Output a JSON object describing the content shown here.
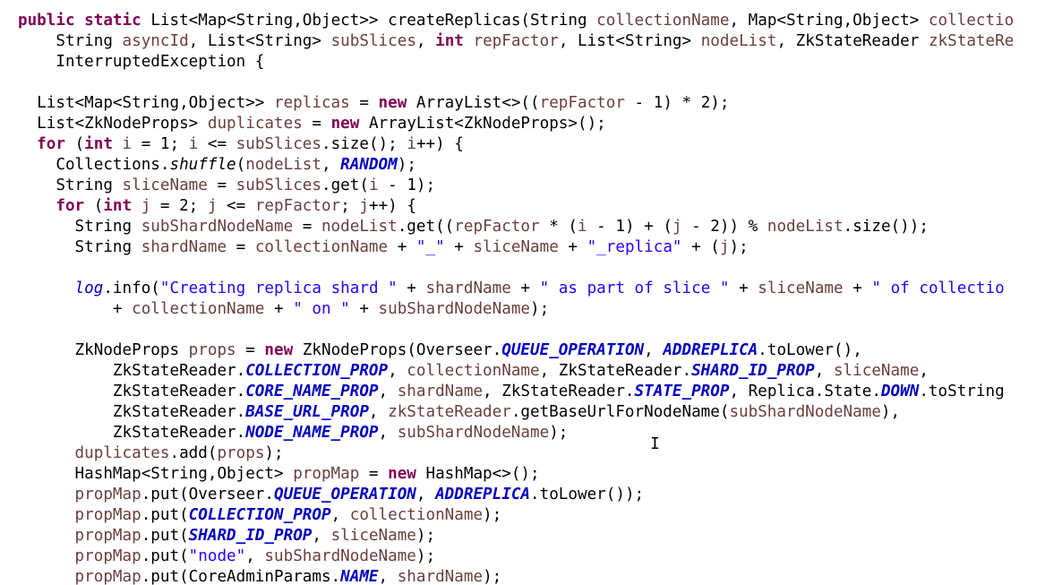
{
  "editor": {
    "cursor_glyph": "I",
    "lines": [
      [
        [
          "kw",
          "public "
        ],
        [
          "kw",
          "static "
        ],
        [
          "pl",
          "List<Map<String,Object>> createReplicas(String "
        ],
        [
          "var",
          "collectionName"
        ],
        [
          "pl",
          ", Map<String,Object> "
        ],
        [
          "var",
          "collectio"
        ]
      ],
      [
        [
          "pl",
          "    String "
        ],
        [
          "var",
          "asyncId"
        ],
        [
          "pl",
          ", List<String> "
        ],
        [
          "var",
          "subSlices"
        ],
        [
          "pl",
          ", "
        ],
        [
          "kw",
          "int "
        ],
        [
          "var",
          "repFactor"
        ],
        [
          "pl",
          ", List<String> "
        ],
        [
          "var",
          "nodeList"
        ],
        [
          "pl",
          ", ZkStateReader "
        ],
        [
          "var",
          "zkStateRe"
        ]
      ],
      [
        [
          "pl",
          "    InterruptedException {"
        ]
      ],
      [
        [
          "pl",
          ""
        ]
      ],
      [
        [
          "pl",
          "  List<Map<String,Object>> "
        ],
        [
          "var",
          "replicas"
        ],
        [
          "pl",
          " = "
        ],
        [
          "kw",
          "new "
        ],
        [
          "pl",
          "ArrayList<>(("
        ],
        [
          "var",
          "repFactor"
        ],
        [
          "pl",
          " - 1) * 2);"
        ]
      ],
      [
        [
          "pl",
          "  List<ZkNodeProps> "
        ],
        [
          "var",
          "duplicates"
        ],
        [
          "pl",
          " = "
        ],
        [
          "kw",
          "new "
        ],
        [
          "pl",
          "ArrayList<ZkNodeProps>();"
        ]
      ],
      [
        [
          "kw",
          "  for "
        ],
        [
          "pl",
          "("
        ],
        [
          "kw",
          "int "
        ],
        [
          "var",
          "i"
        ],
        [
          "pl",
          " = 1; "
        ],
        [
          "var",
          "i"
        ],
        [
          "pl",
          " <= "
        ],
        [
          "var",
          "subSlices"
        ],
        [
          "pl",
          ".size(); "
        ],
        [
          "var",
          "i"
        ],
        [
          "pl",
          "++) {"
        ]
      ],
      [
        [
          "pl",
          "    Collections."
        ],
        [
          "it",
          "shuffle"
        ],
        [
          "pl",
          "("
        ],
        [
          "var",
          "nodeList"
        ],
        [
          "pl",
          ", "
        ],
        [
          "sfld",
          "RANDOM"
        ],
        [
          "pl",
          ");"
        ]
      ],
      [
        [
          "pl",
          "    String "
        ],
        [
          "var",
          "sliceName"
        ],
        [
          "pl",
          " = "
        ],
        [
          "var",
          "subSlices"
        ],
        [
          "pl",
          ".get("
        ],
        [
          "var",
          "i"
        ],
        [
          "pl",
          " - 1);"
        ]
      ],
      [
        [
          "kw",
          "    for "
        ],
        [
          "pl",
          "("
        ],
        [
          "kw",
          "int "
        ],
        [
          "var",
          "j"
        ],
        [
          "pl",
          " = 2; "
        ],
        [
          "var",
          "j"
        ],
        [
          "pl",
          " <= "
        ],
        [
          "var",
          "repFactor"
        ],
        [
          "pl",
          "; "
        ],
        [
          "var",
          "j"
        ],
        [
          "pl",
          "++) {"
        ]
      ],
      [
        [
          "pl",
          "      String "
        ],
        [
          "var",
          "subShardNodeName"
        ],
        [
          "pl",
          " = "
        ],
        [
          "var",
          "nodeList"
        ],
        [
          "pl",
          ".get(("
        ],
        [
          "var",
          "repFactor"
        ],
        [
          "pl",
          " * ("
        ],
        [
          "var",
          "i"
        ],
        [
          "pl",
          " - 1) + ("
        ],
        [
          "var",
          "j"
        ],
        [
          "pl",
          " - 2)) % "
        ],
        [
          "var",
          "nodeList"
        ],
        [
          "pl",
          ".size());"
        ]
      ],
      [
        [
          "pl",
          "      String "
        ],
        [
          "var",
          "shardName"
        ],
        [
          "pl",
          " = "
        ],
        [
          "var",
          "collectionName"
        ],
        [
          "pl",
          " + "
        ],
        [
          "str",
          "\"_\""
        ],
        [
          "pl",
          " + "
        ],
        [
          "var",
          "sliceName"
        ],
        [
          "pl",
          " + "
        ],
        [
          "str",
          "\"_replica\""
        ],
        [
          "pl",
          " + ("
        ],
        [
          "var",
          "j"
        ],
        [
          "pl",
          ");"
        ]
      ],
      [
        [
          "pl",
          ""
        ]
      ],
      [
        [
          "sfld-plain",
          "      log"
        ],
        [
          "pl",
          ".info("
        ],
        [
          "str",
          "\"Creating replica shard \""
        ],
        [
          "pl",
          " + "
        ],
        [
          "var",
          "shardName"
        ],
        [
          "pl",
          " + "
        ],
        [
          "str",
          "\" as part of slice \""
        ],
        [
          "pl",
          " + "
        ],
        [
          "var",
          "sliceName"
        ],
        [
          "pl",
          " + "
        ],
        [
          "str",
          "\" of collectio"
        ]
      ],
      [
        [
          "pl",
          "          + "
        ],
        [
          "var",
          "collectionName"
        ],
        [
          "pl",
          " + "
        ],
        [
          "str",
          "\" on \""
        ],
        [
          "pl",
          " + "
        ],
        [
          "var",
          "subShardNodeName"
        ],
        [
          "pl",
          ");"
        ]
      ],
      [
        [
          "pl",
          ""
        ]
      ],
      [
        [
          "pl",
          "      ZkNodeProps "
        ],
        [
          "var",
          "props"
        ],
        [
          "pl",
          " = "
        ],
        [
          "kw",
          "new "
        ],
        [
          "pl",
          "ZkNodeProps(Overseer."
        ],
        [
          "sfld",
          "QUEUE_OPERATION"
        ],
        [
          "pl",
          ", "
        ],
        [
          "sfld",
          "ADDREPLICA"
        ],
        [
          "pl",
          ".toLower(),"
        ]
      ],
      [
        [
          "pl",
          "          ZkStateReader."
        ],
        [
          "sfld",
          "COLLECTION_PROP"
        ],
        [
          "pl",
          ", "
        ],
        [
          "var",
          "collectionName"
        ],
        [
          "pl",
          ", ZkStateReader."
        ],
        [
          "sfld",
          "SHARD_ID_PROP"
        ],
        [
          "pl",
          ", "
        ],
        [
          "var",
          "sliceName"
        ],
        [
          "pl",
          ","
        ]
      ],
      [
        [
          "pl",
          "          ZkStateReader."
        ],
        [
          "sfld",
          "CORE_NAME_PROP"
        ],
        [
          "pl",
          ", "
        ],
        [
          "var",
          "shardName"
        ],
        [
          "pl",
          ", ZkStateReader."
        ],
        [
          "sfld",
          "STATE_PROP"
        ],
        [
          "pl",
          ", Replica.State."
        ],
        [
          "sfld",
          "DOWN"
        ],
        [
          "pl",
          ".toString"
        ]
      ],
      [
        [
          "pl",
          "          ZkStateReader."
        ],
        [
          "sfld",
          "BASE_URL_PROP"
        ],
        [
          "pl",
          ", "
        ],
        [
          "var",
          "zkStateReader"
        ],
        [
          "pl",
          ".getBaseUrlForNodeName("
        ],
        [
          "var",
          "subShardNodeName"
        ],
        [
          "pl",
          "),"
        ]
      ],
      [
        [
          "pl",
          "          ZkStateReader."
        ],
        [
          "sfld",
          "NODE_NAME_PROP"
        ],
        [
          "pl",
          ", "
        ],
        [
          "var",
          "subShardNodeName"
        ],
        [
          "pl",
          ");"
        ]
      ],
      [
        [
          "var",
          "      duplicates"
        ],
        [
          "pl",
          ".add("
        ],
        [
          "var",
          "props"
        ],
        [
          "pl",
          ");"
        ]
      ],
      [
        [
          "pl",
          "      HashMap<String,Object> "
        ],
        [
          "var",
          "propMap"
        ],
        [
          "pl",
          " = "
        ],
        [
          "kw",
          "new "
        ],
        [
          "pl",
          "HashMap<>();"
        ]
      ],
      [
        [
          "var",
          "      propMap"
        ],
        [
          "pl",
          ".put(Overseer."
        ],
        [
          "sfld",
          "QUEUE_OPERATION"
        ],
        [
          "pl",
          ", "
        ],
        [
          "sfld",
          "ADDREPLICA"
        ],
        [
          "pl",
          ".toLower());"
        ]
      ],
      [
        [
          "var",
          "      propMap"
        ],
        [
          "pl",
          ".put("
        ],
        [
          "sfld",
          "COLLECTION_PROP"
        ],
        [
          "pl",
          ", "
        ],
        [
          "var",
          "collectionName"
        ],
        [
          "pl",
          ");"
        ]
      ],
      [
        [
          "var",
          "      propMap"
        ],
        [
          "pl",
          ".put("
        ],
        [
          "sfld",
          "SHARD_ID_PROP"
        ],
        [
          "pl",
          ", "
        ],
        [
          "var",
          "sliceName"
        ],
        [
          "pl",
          ");"
        ]
      ],
      [
        [
          "var",
          "      propMap"
        ],
        [
          "pl",
          ".put("
        ],
        [
          "str",
          "\"node\""
        ],
        [
          "pl",
          ", "
        ],
        [
          "var",
          "subShardNodeName"
        ],
        [
          "pl",
          ");"
        ]
      ],
      [
        [
          "var",
          "      propMap"
        ],
        [
          "pl",
          ".put(CoreAdminParams."
        ],
        [
          "sfld",
          "NAME"
        ],
        [
          "pl",
          ", "
        ],
        [
          "var",
          "shardName"
        ],
        [
          "pl",
          ");"
        ]
      ]
    ]
  }
}
